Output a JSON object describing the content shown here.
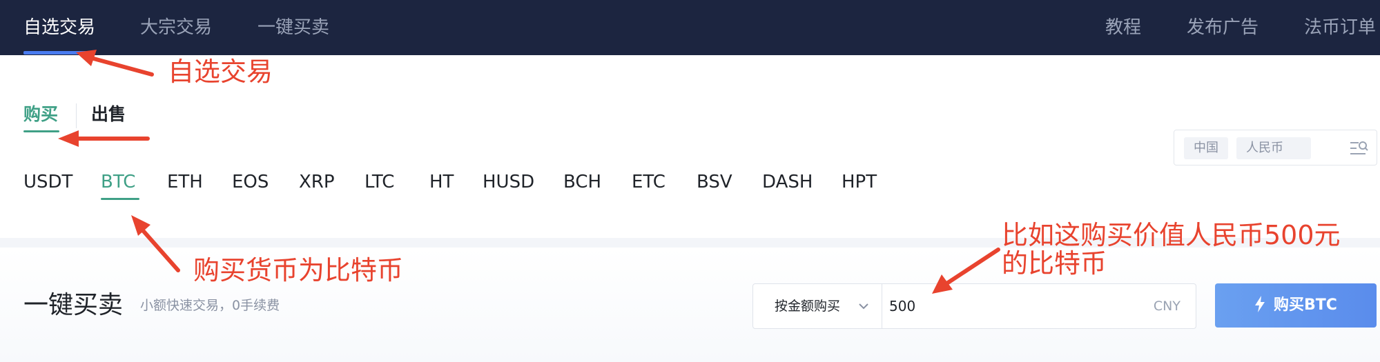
{
  "topnav": {
    "left": [
      {
        "label": "自选交易",
        "active": true
      },
      {
        "label": "大宗交易",
        "active": false
      },
      {
        "label": "一键买卖",
        "active": false
      }
    ],
    "right": [
      {
        "label": "教程"
      },
      {
        "label": "发布广告"
      },
      {
        "label": "法币订单"
      }
    ]
  },
  "tabs": {
    "buy": "购买",
    "sell": "出售",
    "active": "buy"
  },
  "coins": [
    "USDT",
    "BTC",
    "ETH",
    "EOS",
    "XRP",
    "LTC",
    "HT",
    "HUSD",
    "BCH",
    "ETC",
    "BSV",
    "DASH",
    "HPT"
  ],
  "selected_coin": "BTC",
  "filter": {
    "country": "中国",
    "currency": "人民币",
    "icon": "filter-search-icon"
  },
  "quick_trade": {
    "title": "一键买卖",
    "subtitle": "小额快速交易，0手续费",
    "mode": "按金额购买",
    "amount": "500",
    "currency": "CNY",
    "button": "购买BTC",
    "button_icon": "lightning-icon"
  },
  "annotations": {
    "a1": "自选交易",
    "a2": "购买货币为比特币",
    "a3_line1": "比如这购买价值人民币500元",
    "a3_line2": "的比特币"
  },
  "colors": {
    "nav_bg": "#1c2540",
    "accent_green": "#3fa086",
    "accent_blue": "#4a7cf0",
    "button_blue": "#5a8cec",
    "annotation_red": "#e8432e"
  }
}
